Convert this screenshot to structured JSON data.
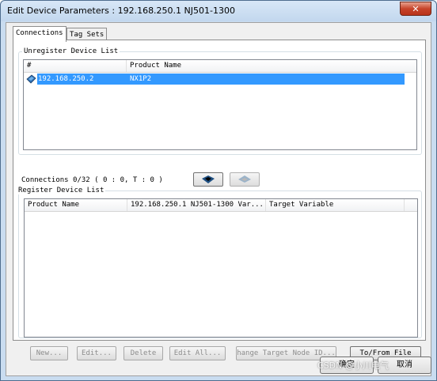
{
  "window": {
    "title": "Edit Device Parameters : 192.168.250.1 NJ501-1300",
    "close_label": "✕"
  },
  "tabs": [
    {
      "label": "Connections"
    },
    {
      "label": "Tag Sets"
    }
  ],
  "unregister": {
    "group_label": "Unregister Device List",
    "columns": [
      "#",
      "Product Name"
    ],
    "rows": [
      {
        "address": "192.168.250.2",
        "product": "NX1P2"
      }
    ]
  },
  "connections_status": "Connections 0/32 ( 0 : 0, T : 0 )",
  "register": {
    "group_label": "Register Device List",
    "columns": [
      "Product Name",
      "192.168.250.1 NJ501-1300 Var...",
      "Target Variable"
    ]
  },
  "buttons": {
    "new": "New...",
    "edit": "Edit...",
    "delete": "Delete",
    "edit_all": "Edit All...",
    "change_target": "hange Target Node ID...",
    "to_from_file": "To/From File"
  },
  "dialog_buttons": {
    "ok": "确定",
    "cancel": "取消"
  },
  "watermark": "CSDN @小川电气",
  "colors": {
    "selection": "#3399ff",
    "titlebar": "#c2d7ee"
  }
}
